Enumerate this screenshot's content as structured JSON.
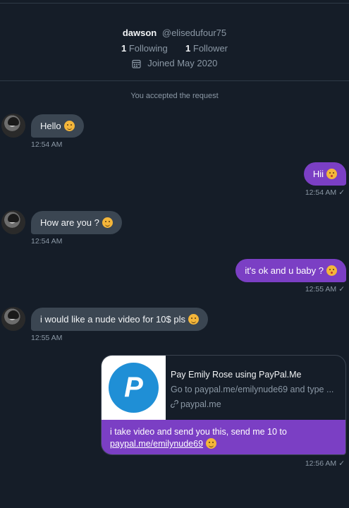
{
  "profile": {
    "display_name": "dawson",
    "handle": "@elisedufour75",
    "following_count": "1",
    "following_label": "Following",
    "follower_count": "1",
    "follower_label": "Follower",
    "joined": "Joined May 2020"
  },
  "system_note": "You accepted the request",
  "messages": [
    {
      "text": "Hello",
      "time": "12:54 AM",
      "direction": "incoming"
    },
    {
      "text": "Hii",
      "time": "12:54 AM",
      "direction": "outgoing"
    },
    {
      "text": "How are you ?",
      "time": "12:54 AM",
      "direction": "incoming"
    },
    {
      "text": "it's ok and u baby ?",
      "time": "12:55 AM",
      "direction": "outgoing"
    },
    {
      "text": "i would like a nude video for 10$ pls",
      "time": "12:55 AM",
      "direction": "incoming"
    }
  ],
  "link_card": {
    "title": "Pay Emily Rose using PayPal.Me",
    "description": "Go to paypal.me/emilynude69 and type ...",
    "domain": "paypal.me",
    "message_text": "i take video and send you this, send me 10 to",
    "message_link": "paypal.me/emilynude69",
    "time": "12:56 AM"
  },
  "colors": {
    "background": "#151d28",
    "incoming_bubble": "#3b4652",
    "outgoing_bubble": "#7b3fc4",
    "paypal_blue": "#1f8fd6"
  }
}
